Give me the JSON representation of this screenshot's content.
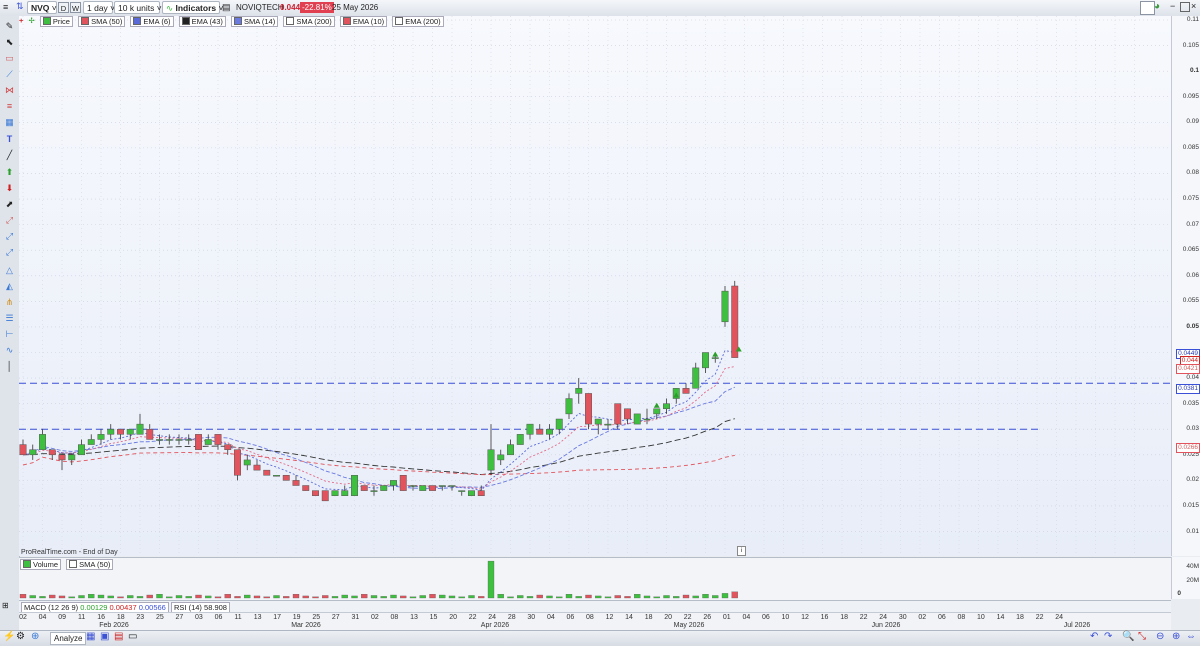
{
  "topbar": {
    "symbol": "NVQ",
    "period_d": "D",
    "period_w": "W",
    "timeframe": "1 day",
    "units": "10 k units",
    "indicators_label": "Indicators",
    "instrument_name": "NOVIQTECH",
    "last_price": "0.044",
    "change_pct": "-22.81%",
    "date": "25 May 2026"
  },
  "legend": {
    "price": "Price",
    "items": [
      "SMA (50)",
      "EMA (6)",
      "EMA (43)",
      "SMA (14)",
      "SMA (200)",
      "EMA (10)",
      "EMA (200)"
    ]
  },
  "price_axis": {
    "labels": [
      "0.11",
      "0.105",
      "0.1",
      "0.095",
      "0.09",
      "0.085",
      "0.08",
      "0.075",
      "0.07",
      "0.065",
      "0.06",
      "0.055",
      "0.05",
      "0.045",
      "0.04",
      "0.035",
      "0.03",
      "0.025",
      "0.02",
      "0.015",
      "0.01"
    ],
    "tags": [
      "0.0449",
      "0.044",
      "0.0421",
      "0.0381",
      "0.0266"
    ]
  },
  "watermark": "ProRealTime.com - End of Day",
  "volume_panel": {
    "label": "Volume",
    "sma_label": "SMA (50)",
    "axis": [
      "40M",
      "20M",
      "0"
    ]
  },
  "indicator_bar": {
    "macd_label": "MACD (12 26 9)",
    "macd_v1": "0.00129",
    "macd_v2": "0.00437",
    "macd_v3": "0.00566",
    "rsi_label": "RSI (14)",
    "rsi_value": "58.908"
  },
  "date_axis": {
    "days": [
      "02",
      "04",
      "09",
      "11",
      "16",
      "18",
      "23",
      "25",
      "27",
      "03",
      "06",
      "11",
      "13",
      "17",
      "19",
      "25",
      "27",
      "31",
      "02",
      "08",
      "13",
      "15",
      "20",
      "22",
      "24",
      "28",
      "30",
      "04",
      "06",
      "08",
      "12",
      "14",
      "18",
      "20",
      "22",
      "26",
      "01",
      "04",
      "06",
      "10",
      "12",
      "16",
      "18",
      "22",
      "24",
      "30",
      "02",
      "06",
      "08",
      "10",
      "14",
      "18",
      "22",
      "24"
    ],
    "months": [
      "Feb 2026",
      "Mar 2026",
      "Apr 2026",
      "May 2026",
      "Jun 2026",
      "Jul 2026"
    ]
  },
  "bottombar": {
    "analyze": "Analyze"
  },
  "colors": {
    "up": "#3fbf3f",
    "down": "#e2545d",
    "hline": "#3a50d6",
    "bg": "#eef2fb"
  },
  "chart_data": {
    "type": "candlestick",
    "y_range": [
      0.006,
      0.11
    ],
    "horizontal_lines": [
      0.039,
      0.03
    ],
    "candles": [
      [
        0.027,
        0.028,
        0.025,
        0.025
      ],
      [
        0.025,
        0.027,
        0.024,
        0.026
      ],
      [
        0.026,
        0.03,
        0.026,
        0.029
      ],
      [
        0.026,
        0.026,
        0.024,
        0.025
      ],
      [
        0.025,
        0.025,
        0.022,
        0.024
      ],
      [
        0.024,
        0.025,
        0.023,
        0.025
      ],
      [
        0.025,
        0.028,
        0.025,
        0.027
      ],
      [
        0.027,
        0.029,
        0.027,
        0.028
      ],
      [
        0.028,
        0.03,
        0.027,
        0.029
      ],
      [
        0.029,
        0.031,
        0.028,
        0.03
      ],
      [
        0.03,
        0.03,
        0.028,
        0.029
      ],
      [
        0.029,
        0.03,
        0.028,
        0.03
      ],
      [
        0.029,
        0.033,
        0.029,
        0.031
      ],
      [
        0.03,
        0.031,
        0.028,
        0.028
      ],
      [
        0.028,
        0.029,
        0.027,
        0.028
      ],
      [
        0.028,
        0.029,
        0.027,
        0.028
      ],
      [
        0.028,
        0.029,
        0.027,
        0.028
      ],
      [
        0.028,
        0.029,
        0.027,
        0.028
      ],
      [
        0.029,
        0.029,
        0.026,
        0.026
      ],
      [
        0.027,
        0.029,
        0.027,
        0.028
      ],
      [
        0.029,
        0.029,
        0.026,
        0.027
      ],
      [
        0.027,
        0.027,
        0.025,
        0.026
      ],
      [
        0.026,
        0.026,
        0.02,
        0.021
      ],
      [
        0.023,
        0.025,
        0.022,
        0.024
      ],
      [
        0.023,
        0.024,
        0.022,
        0.022
      ],
      [
        0.022,
        0.022,
        0.021,
        0.021
      ],
      [
        0.021,
        0.021,
        0.021,
        0.021
      ],
      [
        0.021,
        0.021,
        0.02,
        0.02
      ],
      [
        0.02,
        0.021,
        0.019,
        0.019
      ],
      [
        0.019,
        0.019,
        0.018,
        0.018
      ],
      [
        0.018,
        0.018,
        0.017,
        0.017
      ],
      [
        0.018,
        0.018,
        0.016,
        0.016
      ],
      [
        0.017,
        0.018,
        0.017,
        0.018
      ],
      [
        0.017,
        0.019,
        0.017,
        0.018
      ],
      [
        0.017,
        0.021,
        0.017,
        0.021
      ],
      [
        0.019,
        0.019,
        0.018,
        0.018
      ],
      [
        0.018,
        0.019,
        0.017,
        0.018
      ],
      [
        0.018,
        0.019,
        0.018,
        0.019
      ],
      [
        0.019,
        0.02,
        0.018,
        0.02
      ],
      [
        0.021,
        0.021,
        0.018,
        0.018
      ],
      [
        0.019,
        0.019,
        0.018,
        0.019
      ],
      [
        0.018,
        0.019,
        0.018,
        0.019
      ],
      [
        0.019,
        0.019,
        0.018,
        0.018
      ],
      [
        0.019,
        0.019,
        0.018,
        0.019
      ],
      [
        0.019,
        0.019,
        0.018,
        0.019
      ],
      [
        0.018,
        0.018,
        0.017,
        0.018
      ],
      [
        0.017,
        0.018,
        0.017,
        0.018
      ],
      [
        0.018,
        0.019,
        0.017,
        0.017
      ],
      [
        0.022,
        0.031,
        0.021,
        0.026
      ],
      [
        0.024,
        0.026,
        0.023,
        0.025
      ],
      [
        0.025,
        0.028,
        0.025,
        0.027
      ],
      [
        0.027,
        0.029,
        0.027,
        0.029
      ],
      [
        0.029,
        0.031,
        0.028,
        0.031
      ],
      [
        0.03,
        0.031,
        0.029,
        0.029
      ],
      [
        0.029,
        0.031,
        0.028,
        0.03
      ],
      [
        0.03,
        0.032,
        0.029,
        0.032
      ],
      [
        0.033,
        0.037,
        0.032,
        0.036
      ],
      [
        0.037,
        0.04,
        0.035,
        0.038
      ],
      [
        0.037,
        0.037,
        0.03,
        0.031
      ],
      [
        0.031,
        0.032,
        0.029,
        0.032
      ],
      [
        0.031,
        0.032,
        0.03,
        0.031
      ],
      [
        0.035,
        0.035,
        0.03,
        0.031
      ],
      [
        0.034,
        0.034,
        0.031,
        0.032
      ],
      [
        0.031,
        0.033,
        0.031,
        0.033
      ],
      [
        0.032,
        0.034,
        0.031,
        0.032
      ],
      [
        0.033,
        0.034,
        0.032,
        0.034
      ],
      [
        0.034,
        0.036,
        0.033,
        0.035
      ],
      [
        0.036,
        0.038,
        0.035,
        0.038
      ],
      [
        0.038,
        0.039,
        0.037,
        0.037
      ],
      [
        0.038,
        0.043,
        0.038,
        0.042
      ],
      [
        0.042,
        0.045,
        0.041,
        0.045
      ],
      [
        0.044,
        0.045,
        0.043,
        0.044
      ],
      [
        0.051,
        0.058,
        0.05,
        0.057
      ],
      [
        0.058,
        0.059,
        0.044,
        0.044
      ]
    ]
  }
}
